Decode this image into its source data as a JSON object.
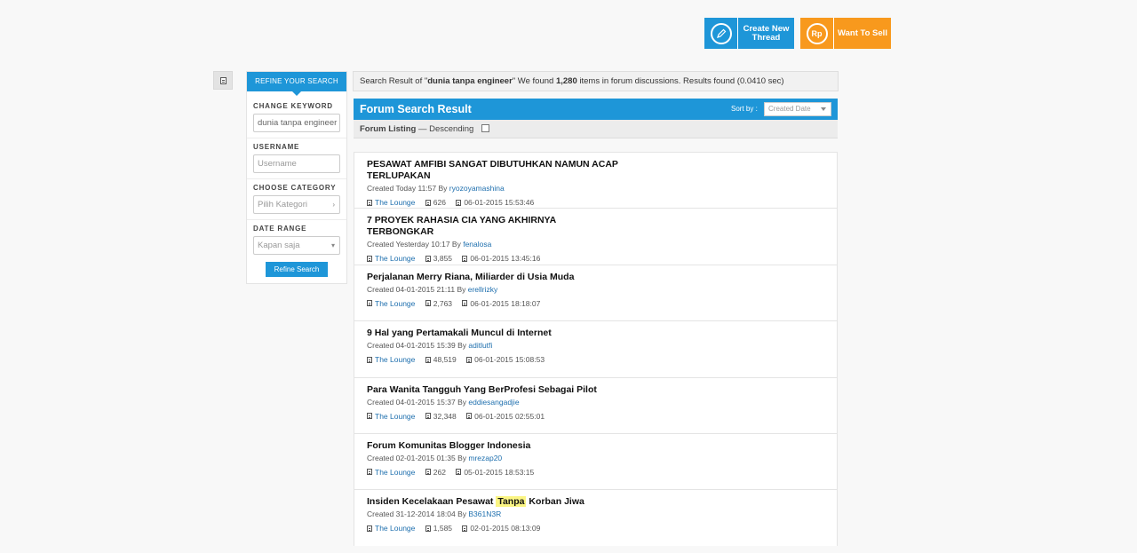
{
  "actions": {
    "create_thread": "Create New Thread",
    "want_to_sell": "Want To Sell",
    "rp_symbol": "Rp"
  },
  "refine": {
    "tab": "REFINE YOUR SEARCH",
    "keyword_label": "CHANGE KEYWORD",
    "keyword_value": "dunia tanpa engineer",
    "username_label": "USERNAME",
    "username_placeholder": "Username",
    "category_label": "CHOOSE CATEGORY",
    "category_value": "Pilih Kategori",
    "date_label": "DATE RANGE",
    "date_value": "Kapan saja",
    "button": "Refine Search"
  },
  "summary": {
    "prefix": "Search Result of \"",
    "query": "dunia tanpa engineer",
    "mid": "\" We found ",
    "count": "1,280",
    "suffix": " items in forum discussions. Results found (0.0410 sec)"
  },
  "results_header": {
    "title": "Forum Search Result",
    "sort_label": "Sort by :",
    "sort_value": "Created Date"
  },
  "listing": {
    "label": "Forum Listing",
    "order": " — Descending"
  },
  "results": [
    {
      "title": "PESAWAT AMFIBI SANGAT DIBUTUHKAN NAMUN ACAP TERLUPAKAN",
      "created": "Created Today 11:57 By ",
      "author": "ryozoyamashina",
      "forum": "The Lounge",
      "views": "626",
      "last": "06-01-2015 15:53:46"
    },
    {
      "title": "7 PROYEK RAHASIA CIA YANG AKHIRNYA TERBONGKAR",
      "created": "Created Yesterday 10:17 By ",
      "author": "fenalosa",
      "forum": "The Lounge",
      "views": "3,855",
      "last": "06-01-2015 13:45:16"
    },
    {
      "title": "Perjalanan Merry Riana, Miliarder di Usia Muda",
      "created": "Created 04-01-2015 21:11 By ",
      "author": "erellrizky",
      "forum": "The Lounge",
      "views": "2,763",
      "last": "06-01-2015 18:18:07"
    },
    {
      "title": "9 Hal yang Pertamakali Muncul di Internet",
      "created": "Created 04-01-2015 15:39 By ",
      "author": "aditlutfi",
      "forum": "The Lounge",
      "views": "48,519",
      "last": "06-01-2015 15:08:53"
    },
    {
      "title": "Para Wanita Tangguh Yang BerProfesi Sebagai Pilot",
      "created": "Created 04-01-2015 15:37 By ",
      "author": "eddiesangadjie",
      "forum": "The Lounge",
      "views": "32,348",
      "last": "06-01-2015 02:55:01"
    },
    {
      "title": "Forum Komunitas Blogger Indonesia",
      "created": "Created 02-01-2015 01:35 By ",
      "author": "mrezap20",
      "forum": "The Lounge",
      "views": "262",
      "last": "05-01-2015 18:53:15"
    },
    {
      "title_pre": "Insiden Kecelakaan Pesawat ",
      "title_hl": "Tanpa",
      "title_post": " Korban Jiwa",
      "created": "Created 31-12-2014 18:04 By ",
      "author": "B361N3R",
      "forum": "The Lounge",
      "views": "1,585",
      "last": "02-01-2015 08:13:09"
    }
  ]
}
